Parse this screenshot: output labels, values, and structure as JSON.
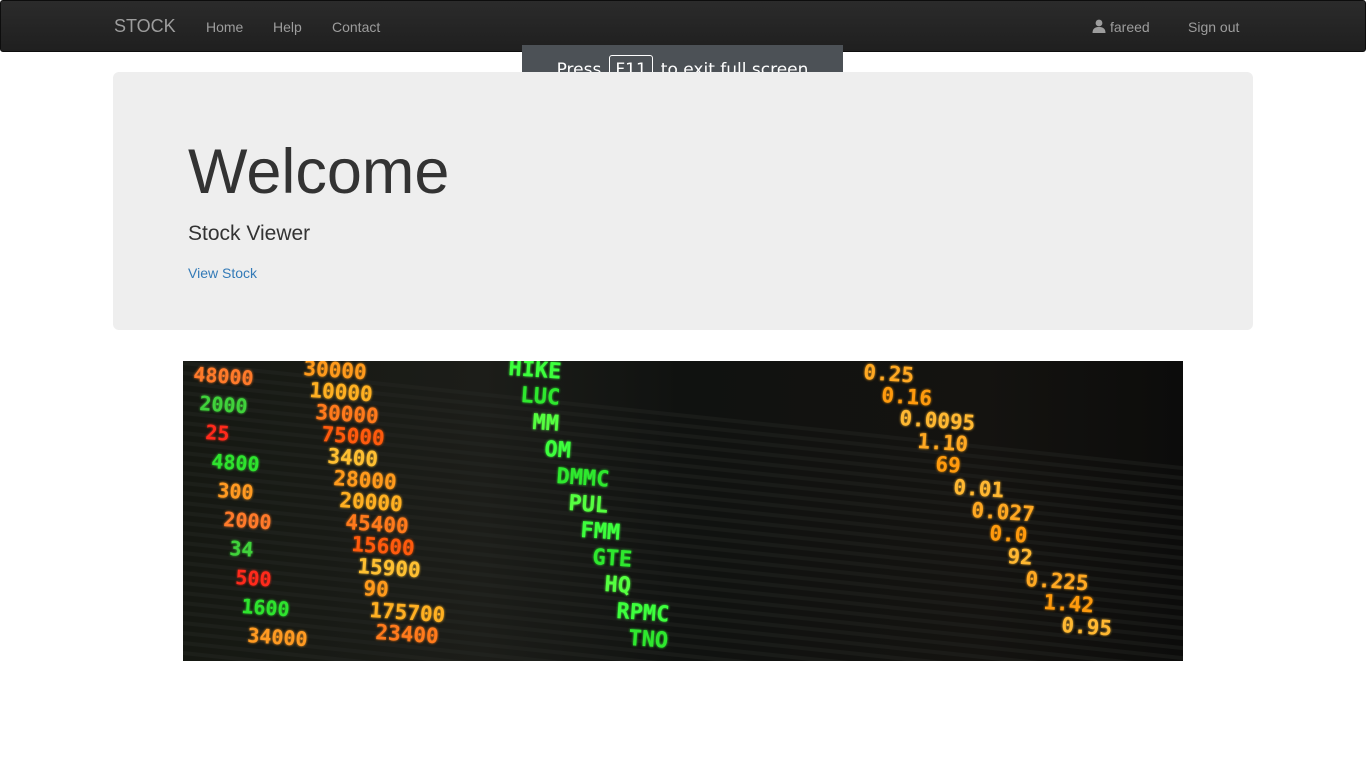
{
  "navbar": {
    "brand": "STOCK",
    "links": [
      {
        "label": "Home"
      },
      {
        "label": "Help"
      },
      {
        "label": "Contact"
      }
    ],
    "user": {
      "name": "fareed",
      "icon": "user-icon"
    },
    "signout_label": "Sign out"
  },
  "fullscreen_notice": {
    "before": "Press",
    "key": "F11",
    "after": "to exit full screen"
  },
  "jumbotron": {
    "title": "Welcome",
    "subtitle": "Stock Viewer",
    "link_label": "View Stock"
  },
  "hero_image": {
    "board_rows": {
      "left": [
        "48000",
        "2000",
        "25",
        "4800",
        "300",
        "2000",
        "34",
        "500",
        "1600",
        "34000"
      ],
      "mid_left": [
        "30000",
        "10000",
        "30000",
        "75000",
        "3400",
        "28000",
        "20000",
        "45400",
        "15600",
        "15900",
        "90",
        "175700",
        "23400"
      ],
      "green": [
        "HIKE",
        "LUC",
        "MM",
        "OM",
        "DMMC",
        "PUL",
        "FMM",
        "GTE",
        "HQ",
        "RPMC",
        "TNO"
      ],
      "right": [
        "0.25",
        "0.16",
        "0.0095",
        "1.10",
        "69",
        "0.01",
        "0.027",
        "0.0",
        "92",
        "0.225",
        "1.42",
        "0.95"
      ]
    }
  }
}
